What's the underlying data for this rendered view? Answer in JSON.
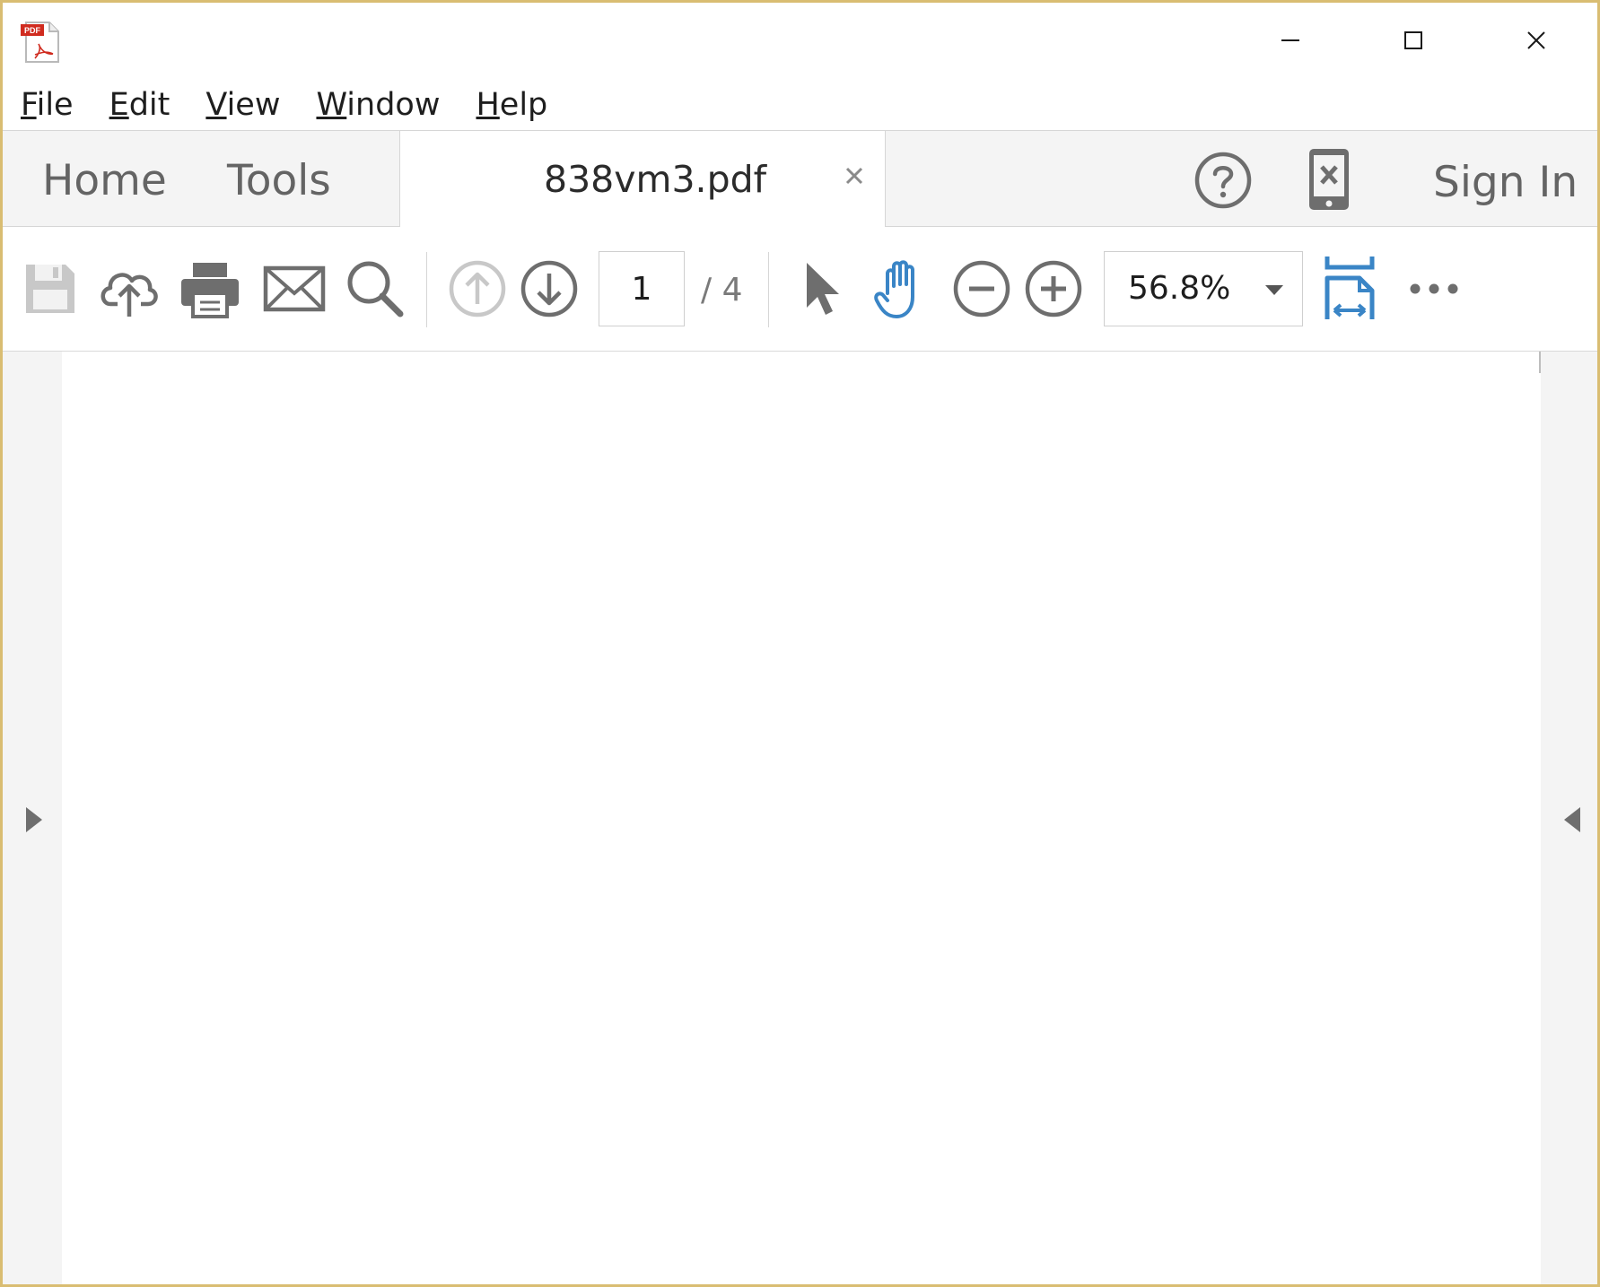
{
  "window": {
    "app_icon": "acrobat-pdf-icon",
    "app_icon_label": "PDF",
    "controls": [
      "minimize-icon",
      "maximize-icon",
      "close-icon"
    ]
  },
  "menu": {
    "items": [
      {
        "label_mnemonic": "F",
        "label_rest": "ile"
      },
      {
        "label_mnemonic": "E",
        "label_rest": "dit"
      },
      {
        "label_mnemonic": "V",
        "label_rest": "iew"
      },
      {
        "label_mnemonic": "W",
        "label_rest": "indow"
      },
      {
        "label_mnemonic": "H",
        "label_rest": "elp"
      }
    ]
  },
  "tabs": {
    "home": "Home",
    "tools": "Tools",
    "document": "838vm3.pdf",
    "sign_in": "Sign In"
  },
  "toolbar": {
    "icons": [
      "save-icon",
      "cloud-upload-icon",
      "print-icon",
      "email-icon",
      "search-icon",
      "previous-page-icon",
      "next-page-icon",
      "select-cursor-icon",
      "hand-tool-icon",
      "zoom-out-icon",
      "zoom-in-icon",
      "fit-page-icon",
      "more-icon"
    ],
    "current_page": "1",
    "page_total": "/  4",
    "zoom": "56.8%"
  },
  "colors": {
    "window_border": "#d9bd72",
    "accent_blue": "#3a85c6",
    "icon_gray": "#6e6e6e",
    "pdf_red": "#d02b1f"
  }
}
